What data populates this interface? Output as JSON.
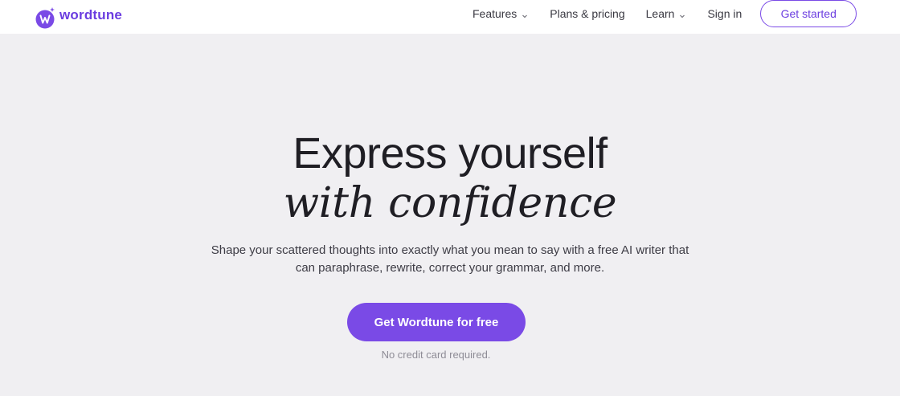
{
  "brand": {
    "name": "wordtune",
    "accent_color": "#7a4ae6",
    "logo_icon": "wordtune-logo-icon"
  },
  "nav": {
    "items": [
      {
        "label": "Features",
        "has_dropdown": true
      },
      {
        "label": "Plans & pricing",
        "has_dropdown": false
      },
      {
        "label": "Learn",
        "has_dropdown": true
      },
      {
        "label": "Sign in",
        "has_dropdown": false
      }
    ],
    "cta_label": "Get started"
  },
  "hero": {
    "headline_line1": "Express yourself",
    "headline_line2": "with confidence",
    "subtext": "Shape your scattered thoughts into exactly what you mean to say with a free AI writer that can paraphrase, rewrite, correct your grammar, and more.",
    "cta_label": "Get Wordtune for free",
    "cta_note": "No credit card required."
  }
}
